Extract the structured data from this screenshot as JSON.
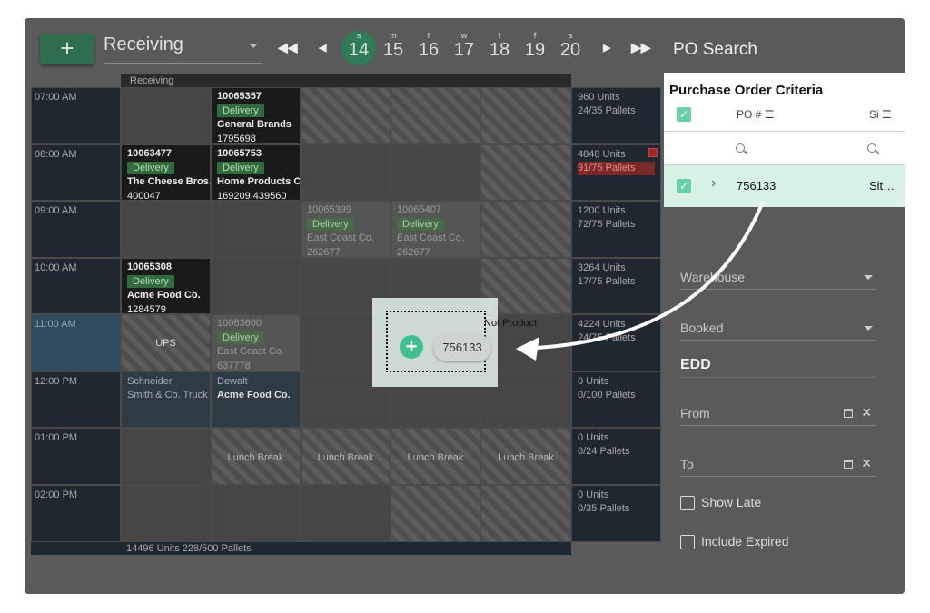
{
  "toolbar": {
    "add_label": "+",
    "view_select": "Receiving",
    "nav_first": "◀◀",
    "nav_prev": "◀",
    "nav_next": "▶",
    "nav_last": "▶▶",
    "days": [
      {
        "letter": "s",
        "num": "14",
        "selected": true
      },
      {
        "letter": "m",
        "num": "15"
      },
      {
        "letter": "t",
        "num": "16"
      },
      {
        "letter": "w",
        "num": "17"
      },
      {
        "letter": "t",
        "num": "18"
      },
      {
        "letter": "f",
        "num": "19"
      },
      {
        "letter": "s",
        "num": "20"
      }
    ]
  },
  "schedule": {
    "column_header": "Receiving",
    "times": [
      "07:00 AM",
      "08:00 AM",
      "09:00 AM",
      "10:00 AM",
      "11:00 AM",
      "12:00 PM",
      "01:00 PM",
      "02:00 PM"
    ],
    "summaries": [
      {
        "units": "960 Units",
        "pallets": "24/35 Pallets"
      },
      {
        "units": "4848 Units",
        "pallets": "91/75 Pallets"
      },
      {
        "units": "1200 Units",
        "pallets": "72/75 Pallets"
      },
      {
        "units": "3264 Units",
        "pallets": "17/75 Pallets"
      },
      {
        "units": "4224 Units",
        "pallets": "24/75 Pallets"
      },
      {
        "units": "0 Units",
        "pallets": "0/100 Pallets"
      },
      {
        "units": "0 Units",
        "pallets": "0/24 Pallets"
      },
      {
        "units": "0 Units",
        "pallets": "0/35 Pallets"
      }
    ],
    "appointments": {
      "a1": {
        "po": "10065357",
        "type": "Delivery",
        "customer": "General Brands",
        "ref": "1795698"
      },
      "a2": {
        "po": "10063477",
        "type": "Delivery",
        "customer": "The Cheese Bros.",
        "ref": "400047"
      },
      "a3": {
        "po": "10065753",
        "type": "Delivery",
        "customer": "Home Products Co",
        "ref": "169209,439560"
      },
      "a4": {
        "po": "10065399",
        "type": "Delivery",
        "customer": "East Coast Co.",
        "ref": "262677"
      },
      "a5": {
        "po": "10065407",
        "type": "Delivery",
        "customer": "East Coast Co.",
        "ref": "262677"
      },
      "a6": {
        "po": "10065308",
        "type": "Delivery",
        "customer": "Acme Food Co.",
        "ref": "1284579"
      },
      "a7": {
        "po": "10063600",
        "type": "Delivery",
        "customer": "East Coast Co.",
        "ref": "637778"
      }
    },
    "ups": "UPS",
    "carrier1": {
      "line1": "Schneider",
      "line2": "Smith & Co. Truck"
    },
    "carrier2": {
      "line1": "Dewalt",
      "line2": "Acme Food Co."
    },
    "lunch": "Lunch Break",
    "footer": "14496 Units  228/500 Pallets",
    "ghost_label": "Not Product"
  },
  "drag": {
    "po_chip": "756133",
    "plus": "+"
  },
  "sidebar": {
    "title": "PO Search",
    "criteria_title": "Purchase Order Criteria",
    "col_po": "PO #",
    "col_site": "Si",
    "row": {
      "po": "756133",
      "site": "Sit…",
      "expand": "›"
    },
    "warehouse": "Warehouse",
    "booked": "Booked",
    "edd": "EDD",
    "from": "From",
    "to": "To",
    "show_late": "Show Late",
    "include_expired": "Include Expired"
  },
  "colors": {
    "accent": "#3fc08f",
    "selected_day": "#2e7d56",
    "delivery_badge": "#2f6b3c",
    "warning": "#7a2a2a"
  }
}
